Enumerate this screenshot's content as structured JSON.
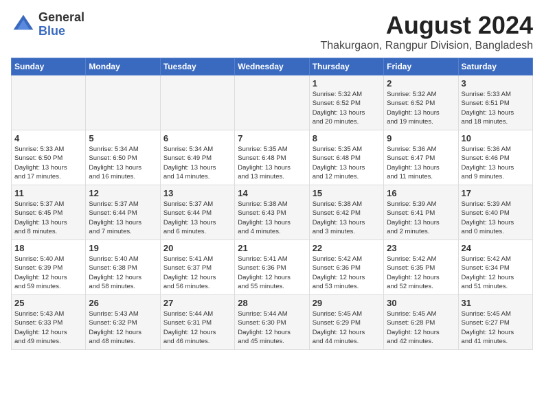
{
  "logo": {
    "general": "General",
    "blue": "Blue"
  },
  "header": {
    "month_year": "August 2024",
    "location": "Thakurgaon, Rangpur Division, Bangladesh"
  },
  "weekdays": [
    "Sunday",
    "Monday",
    "Tuesday",
    "Wednesday",
    "Thursday",
    "Friday",
    "Saturday"
  ],
  "weeks": [
    [
      {
        "day": "",
        "info": ""
      },
      {
        "day": "",
        "info": ""
      },
      {
        "day": "",
        "info": ""
      },
      {
        "day": "",
        "info": ""
      },
      {
        "day": "1",
        "info": "Sunrise: 5:32 AM\nSunset: 6:52 PM\nDaylight: 13 hours\nand 20 minutes."
      },
      {
        "day": "2",
        "info": "Sunrise: 5:32 AM\nSunset: 6:52 PM\nDaylight: 13 hours\nand 19 minutes."
      },
      {
        "day": "3",
        "info": "Sunrise: 5:33 AM\nSunset: 6:51 PM\nDaylight: 13 hours\nand 18 minutes."
      }
    ],
    [
      {
        "day": "4",
        "info": "Sunrise: 5:33 AM\nSunset: 6:50 PM\nDaylight: 13 hours\nand 17 minutes."
      },
      {
        "day": "5",
        "info": "Sunrise: 5:34 AM\nSunset: 6:50 PM\nDaylight: 13 hours\nand 16 minutes."
      },
      {
        "day": "6",
        "info": "Sunrise: 5:34 AM\nSunset: 6:49 PM\nDaylight: 13 hours\nand 14 minutes."
      },
      {
        "day": "7",
        "info": "Sunrise: 5:35 AM\nSunset: 6:48 PM\nDaylight: 13 hours\nand 13 minutes."
      },
      {
        "day": "8",
        "info": "Sunrise: 5:35 AM\nSunset: 6:48 PM\nDaylight: 13 hours\nand 12 minutes."
      },
      {
        "day": "9",
        "info": "Sunrise: 5:36 AM\nSunset: 6:47 PM\nDaylight: 13 hours\nand 11 minutes."
      },
      {
        "day": "10",
        "info": "Sunrise: 5:36 AM\nSunset: 6:46 PM\nDaylight: 13 hours\nand 9 minutes."
      }
    ],
    [
      {
        "day": "11",
        "info": "Sunrise: 5:37 AM\nSunset: 6:45 PM\nDaylight: 13 hours\nand 8 minutes."
      },
      {
        "day": "12",
        "info": "Sunrise: 5:37 AM\nSunset: 6:44 PM\nDaylight: 13 hours\nand 7 minutes."
      },
      {
        "day": "13",
        "info": "Sunrise: 5:37 AM\nSunset: 6:44 PM\nDaylight: 13 hours\nand 6 minutes."
      },
      {
        "day": "14",
        "info": "Sunrise: 5:38 AM\nSunset: 6:43 PM\nDaylight: 13 hours\nand 4 minutes."
      },
      {
        "day": "15",
        "info": "Sunrise: 5:38 AM\nSunset: 6:42 PM\nDaylight: 13 hours\nand 3 minutes."
      },
      {
        "day": "16",
        "info": "Sunrise: 5:39 AM\nSunset: 6:41 PM\nDaylight: 13 hours\nand 2 minutes."
      },
      {
        "day": "17",
        "info": "Sunrise: 5:39 AM\nSunset: 6:40 PM\nDaylight: 13 hours\nand 0 minutes."
      }
    ],
    [
      {
        "day": "18",
        "info": "Sunrise: 5:40 AM\nSunset: 6:39 PM\nDaylight: 12 hours\nand 59 minutes."
      },
      {
        "day": "19",
        "info": "Sunrise: 5:40 AM\nSunset: 6:38 PM\nDaylight: 12 hours\nand 58 minutes."
      },
      {
        "day": "20",
        "info": "Sunrise: 5:41 AM\nSunset: 6:37 PM\nDaylight: 12 hours\nand 56 minutes."
      },
      {
        "day": "21",
        "info": "Sunrise: 5:41 AM\nSunset: 6:36 PM\nDaylight: 12 hours\nand 55 minutes."
      },
      {
        "day": "22",
        "info": "Sunrise: 5:42 AM\nSunset: 6:36 PM\nDaylight: 12 hours\nand 53 minutes."
      },
      {
        "day": "23",
        "info": "Sunrise: 5:42 AM\nSunset: 6:35 PM\nDaylight: 12 hours\nand 52 minutes."
      },
      {
        "day": "24",
        "info": "Sunrise: 5:42 AM\nSunset: 6:34 PM\nDaylight: 12 hours\nand 51 minutes."
      }
    ],
    [
      {
        "day": "25",
        "info": "Sunrise: 5:43 AM\nSunset: 6:33 PM\nDaylight: 12 hours\nand 49 minutes."
      },
      {
        "day": "26",
        "info": "Sunrise: 5:43 AM\nSunset: 6:32 PM\nDaylight: 12 hours\nand 48 minutes."
      },
      {
        "day": "27",
        "info": "Sunrise: 5:44 AM\nSunset: 6:31 PM\nDaylight: 12 hours\nand 46 minutes."
      },
      {
        "day": "28",
        "info": "Sunrise: 5:44 AM\nSunset: 6:30 PM\nDaylight: 12 hours\nand 45 minutes."
      },
      {
        "day": "29",
        "info": "Sunrise: 5:45 AM\nSunset: 6:29 PM\nDaylight: 12 hours\nand 44 minutes."
      },
      {
        "day": "30",
        "info": "Sunrise: 5:45 AM\nSunset: 6:28 PM\nDaylight: 12 hours\nand 42 minutes."
      },
      {
        "day": "31",
        "info": "Sunrise: 5:45 AM\nSunset: 6:27 PM\nDaylight: 12 hours\nand 41 minutes."
      }
    ]
  ]
}
